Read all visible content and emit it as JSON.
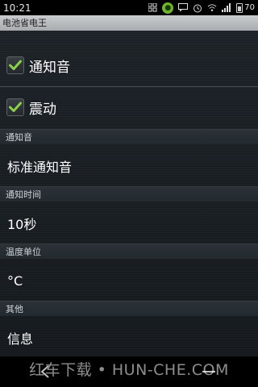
{
  "status_bar": {
    "time": "10:21",
    "battery": "70",
    "icons": [
      "grid-icon",
      "app-icon",
      "message-icon",
      "alarm-icon",
      "wifi-icon",
      "signal-icon",
      "battery-icon"
    ]
  },
  "title_bar": {
    "title": "电池省电王"
  },
  "settings": {
    "notify_sound_check": {
      "label": "通知音",
      "checked": true
    },
    "vibrate_check": {
      "label": "震动",
      "checked": true
    },
    "sections": [
      {
        "header": "通知音",
        "value": "标准通知音"
      },
      {
        "header": "通知时间",
        "value": "10秒"
      },
      {
        "header": "温度单位",
        "value": "°C"
      },
      {
        "header": "其他",
        "value": "信息"
      }
    ]
  },
  "watermark": "红车下载 • HUN-CHE.COM",
  "colors": {
    "check_green": "#8ad14a",
    "background": "#15191d",
    "header_bg": "#262c31"
  }
}
